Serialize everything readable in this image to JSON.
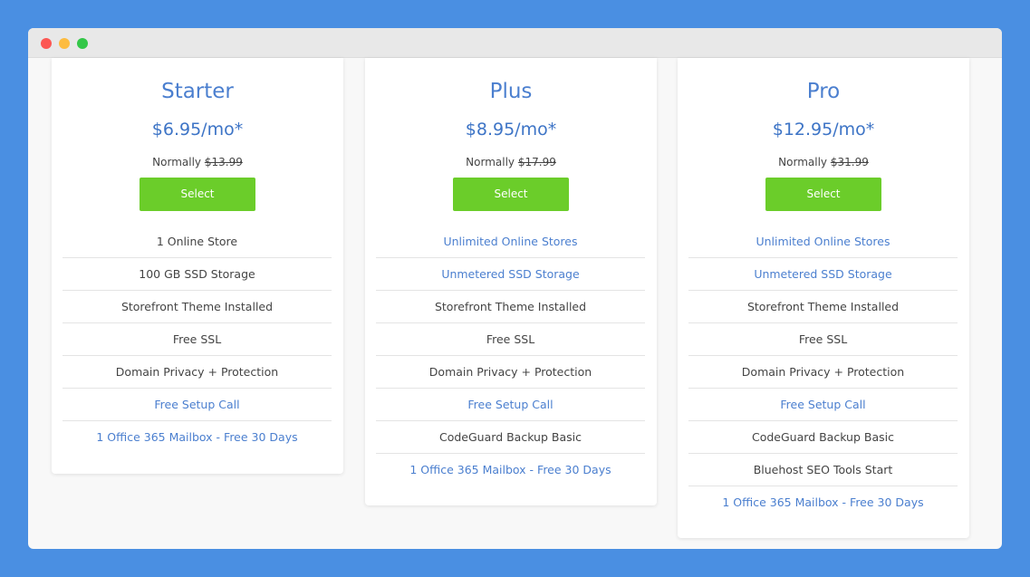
{
  "window": {
    "controls": [
      "close",
      "minimize",
      "maximize"
    ]
  },
  "plans": [
    {
      "name": "Starter",
      "price": "$6.95/mo*",
      "normally_label": "Normally",
      "normally_price": "$13.99",
      "button_label": "Select",
      "features": [
        {
          "text": "1 Online Store",
          "link": false
        },
        {
          "text": "100 GB SSD Storage",
          "link": false
        },
        {
          "text": "Storefront Theme Installed",
          "link": false
        },
        {
          "text": "Free SSL",
          "link": false
        },
        {
          "text": "Domain Privacy + Protection",
          "link": false
        },
        {
          "text": "Free Setup Call",
          "link": true
        },
        {
          "text": "1 Office 365 Mailbox - Free 30 Days",
          "link": true
        }
      ]
    },
    {
      "name": "Plus",
      "price": "$8.95/mo*",
      "normally_label": "Normally",
      "normally_price": "$17.99",
      "button_label": "Select",
      "features": [
        {
          "text": "Unlimited Online Stores",
          "link": true
        },
        {
          "text": "Unmetered SSD Storage",
          "link": true
        },
        {
          "text": "Storefront Theme Installed",
          "link": false
        },
        {
          "text": "Free SSL",
          "link": false
        },
        {
          "text": "Domain Privacy + Protection",
          "link": false
        },
        {
          "text": "Free Setup Call",
          "link": true
        },
        {
          "text": "CodeGuard Backup Basic",
          "link": false
        },
        {
          "text": "1 Office 365 Mailbox - Free 30 Days",
          "link": true
        }
      ]
    },
    {
      "name": "Pro",
      "price": "$12.95/mo*",
      "normally_label": "Normally",
      "normally_price": "$31.99",
      "button_label": "Select",
      "features": [
        {
          "text": "Unlimited Online Stores",
          "link": true
        },
        {
          "text": "Unmetered SSD Storage",
          "link": true
        },
        {
          "text": "Storefront Theme Installed",
          "link": false
        },
        {
          "text": "Free SSL",
          "link": false
        },
        {
          "text": "Domain Privacy + Protection",
          "link": false
        },
        {
          "text": "Free Setup Call",
          "link": true
        },
        {
          "text": "CodeGuard Backup Basic",
          "link": false
        },
        {
          "text": "Bluehost SEO Tools Start",
          "link": false
        },
        {
          "text": "1 Office 365 Mailbox - Free 30 Days",
          "link": true
        }
      ]
    }
  ],
  "colors": {
    "background": "#4a8fe2",
    "accent": "#4b7fcf",
    "button": "#6bcd2a"
  }
}
